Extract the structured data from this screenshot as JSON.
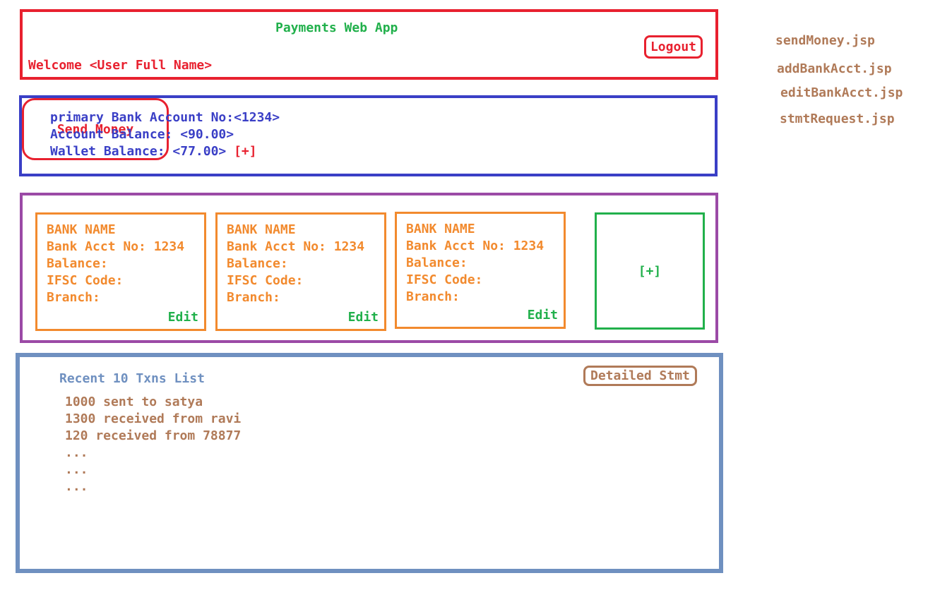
{
  "header": {
    "title": "Payments Web App",
    "welcome": "Welcome <User Full Name>",
    "logout_label": "Logout"
  },
  "summary": {
    "primary_account": "primary Bank Account No:<1234>",
    "account_balance": "Account Balance: <90.00>",
    "wallet_balance": "Wallet Balance: <77.00>",
    "wallet_add_label": "[+]",
    "send_money_label": "Send Money"
  },
  "banks": {
    "cards": [
      {
        "name": "BANK NAME",
        "acct": "Bank Acct No: 1234",
        "balance": "Balance:",
        "ifsc": "IFSC Code:",
        "branch": "Branch:",
        "edit_label": "Edit"
      },
      {
        "name": "BANK NAME",
        "acct": "Bank Acct No: 1234",
        "balance": "Balance:",
        "ifsc": "IFSC Code:",
        "branch": "Branch:",
        "edit_label": "Edit"
      },
      {
        "name": "BANK NAME",
        "acct": "Bank Acct No: 1234",
        "balance": "Balance:",
        "ifsc": "IFSC Code:",
        "branch": "Branch:",
        "edit_label": "Edit"
      }
    ],
    "add_label": "[+]"
  },
  "transactions": {
    "title": "Recent 10 Txns List",
    "detailed_stmt_label": "Detailed Stmt",
    "items": [
      "1000 sent to satya",
      "1300 received from ravi",
      "120 received from 78877",
      "...",
      "...",
      "..."
    ]
  },
  "pages": [
    "sendMoney.jsp",
    "addBankAcct.jsp",
    "editBankAcct.jsp",
    "stmtRequest.jsp"
  ],
  "colors": {
    "header": "#e8212f",
    "summary": "#3a3fc6",
    "banks": "#9b4aa6",
    "bank_card": "#f28a2e",
    "add": "#21b04b",
    "transactions": "#6f90c0",
    "notes": "#b07a58"
  }
}
